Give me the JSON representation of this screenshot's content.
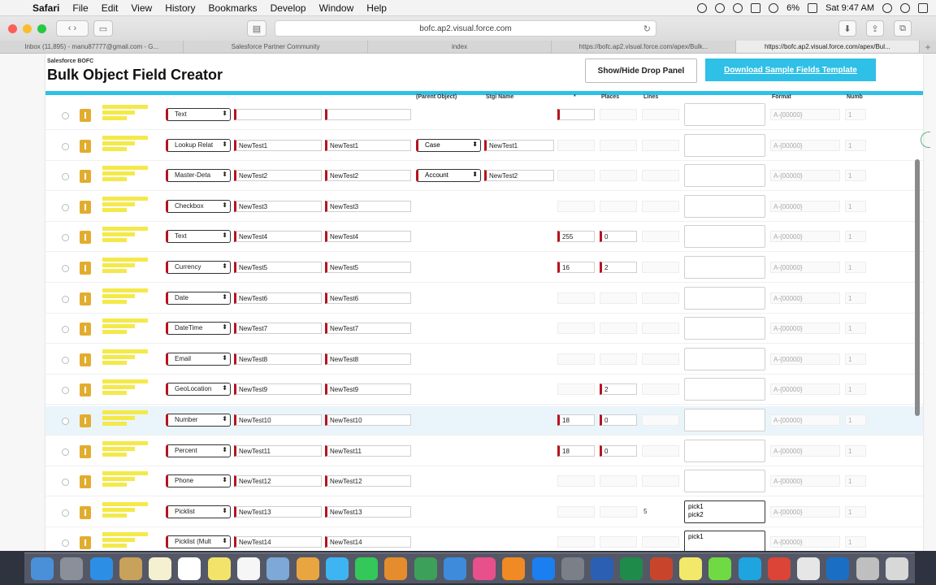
{
  "menubar": {
    "app": "Safari",
    "menus": [
      "File",
      "Edit",
      "View",
      "History",
      "Bookmarks",
      "Develop",
      "Window",
      "Help"
    ],
    "battery": "6%",
    "clock": "Sat 9:47 AM"
  },
  "browser": {
    "url": "bofc.ap2.visual.force.com",
    "tabs": [
      {
        "label": "Inbox (11,895) - manu87777@gmail.com - G..."
      },
      {
        "label": "Salesforce Partner Community"
      },
      {
        "label": "index"
      },
      {
        "label": "https://bofc.ap2.visual.force.com/apex/Bulk..."
      },
      {
        "label": "https://bofc.ap2.visual.force.com/apex/Bul..."
      }
    ],
    "new_tab": "+"
  },
  "page": {
    "brand": "Salesforce BOFC",
    "title": "Bulk Object Field Creator",
    "toggle_button": "Show/Hide Drop Panel",
    "download_button": "Download Sample Fields Template"
  },
  "columns": {
    "parent_object": "(Parent Object)",
    "strip_name": "Stgi Name",
    "length": "*",
    "places": "Places",
    "lines": "Lines",
    "format": "Format",
    "number": "Numb"
  },
  "rows": [
    {
      "type": "Text",
      "label": "",
      "api": "",
      "parent": "",
      "rel": "",
      "length": "",
      "decimal": "",
      "lines": "",
      "values": "",
      "format": "A-{00000}",
      "start": "1"
    },
    {
      "type": "Lookup Relat",
      "label": "NewTest1",
      "api": "NewTest1",
      "parent": "Case",
      "rel": "NewTest1",
      "length": "",
      "decimal": "",
      "lines": "",
      "values": "",
      "format": "A-{00000}",
      "start": "1"
    },
    {
      "type": "Master-Deta",
      "label": "NewTest2",
      "api": "NewTest2",
      "parent": "Account",
      "rel": "NewTest2",
      "length": "",
      "decimal": "",
      "lines": "",
      "values": "",
      "format": "A-{00000}",
      "start": "1"
    },
    {
      "type": "Checkbox",
      "label": "NewTest3",
      "api": "NewTest3",
      "parent": "",
      "rel": "",
      "length": "",
      "decimal": "",
      "lines": "",
      "values": "",
      "format": "A-{00000}",
      "start": "1"
    },
    {
      "type": "Text",
      "label": "NewTest4",
      "api": "NewTest4",
      "parent": "",
      "rel": "",
      "length": "255",
      "decimal": "0",
      "lines": "",
      "values": "",
      "format": "A-{00000}",
      "start": "1"
    },
    {
      "type": "Currency",
      "label": "NewTest5",
      "api": "NewTest5",
      "parent": "",
      "rel": "",
      "length": "16",
      "decimal": "2",
      "lines": "",
      "values": "",
      "format": "A-{00000}",
      "start": "1"
    },
    {
      "type": "Date",
      "label": "NewTest6",
      "api": "NewTest6",
      "parent": "",
      "rel": "",
      "length": "",
      "decimal": "",
      "lines": "",
      "values": "",
      "format": "A-{00000}",
      "start": "1"
    },
    {
      "type": "DateTime",
      "label": "NewTest7",
      "api": "NewTest7",
      "parent": "",
      "rel": "",
      "length": "",
      "decimal": "",
      "lines": "",
      "values": "",
      "format": "A-{00000}",
      "start": "1"
    },
    {
      "type": "Email",
      "label": "NewTest8",
      "api": "NewTest8",
      "parent": "",
      "rel": "",
      "length": "",
      "decimal": "",
      "lines": "",
      "values": "",
      "format": "A-{00000}",
      "start": "1"
    },
    {
      "type": "GeoLocation",
      "label": "NewTest9",
      "api": "NewTest9",
      "parent": "",
      "rel": "",
      "length": "",
      "decimal": "2",
      "lines": "",
      "values": "",
      "format": "A-{00000}",
      "start": "1"
    },
    {
      "type": "Number",
      "label": "NewTest10",
      "api": "NewTest10",
      "parent": "",
      "rel": "",
      "length": "18",
      "decimal": "0",
      "lines": "",
      "values": "",
      "format": "A-{00000}",
      "start": "1"
    },
    {
      "type": "Percent",
      "label": "NewTest11",
      "api": "NewTest11",
      "parent": "",
      "rel": "",
      "length": "18",
      "decimal": "0",
      "lines": "",
      "values": "",
      "format": "A-{00000}",
      "start": "1"
    },
    {
      "type": "Phone",
      "label": "NewTest12",
      "api": "NewTest12",
      "parent": "",
      "rel": "",
      "length": "",
      "decimal": "",
      "lines": "",
      "values": "",
      "format": "A-{00000}",
      "start": "1"
    },
    {
      "type": "Picklist",
      "label": "NewTest13",
      "api": "NewTest13",
      "parent": "",
      "rel": "",
      "length": "",
      "decimal": "",
      "lines": "5",
      "values": "pick1\npick2",
      "format": "A-{00000}",
      "start": "1"
    },
    {
      "type": "Picklist (Mult",
      "label": "NewTest14",
      "api": "NewTest14",
      "parent": "",
      "rel": "",
      "length": "",
      "decimal": "",
      "lines": "",
      "values": "pick1",
      "format": "A-{00000}",
      "start": "1"
    }
  ],
  "dock": [
    "Finder",
    "Launchpad",
    "Safari",
    "Mail",
    "Notes",
    "Calendar",
    "Stickies",
    "Reminders",
    "Preview",
    "Photos",
    "Messages",
    "FaceTime",
    "Books",
    "Numbers",
    "Keynote",
    "iTunes",
    "iBooks",
    "App Store",
    "System Preferences",
    "Word",
    "Excel",
    "PowerPoint",
    "Stickies",
    "Upwork",
    "Skype",
    "Chrome",
    "TextEdit",
    "Outlook",
    "Archive",
    "Trash"
  ]
}
